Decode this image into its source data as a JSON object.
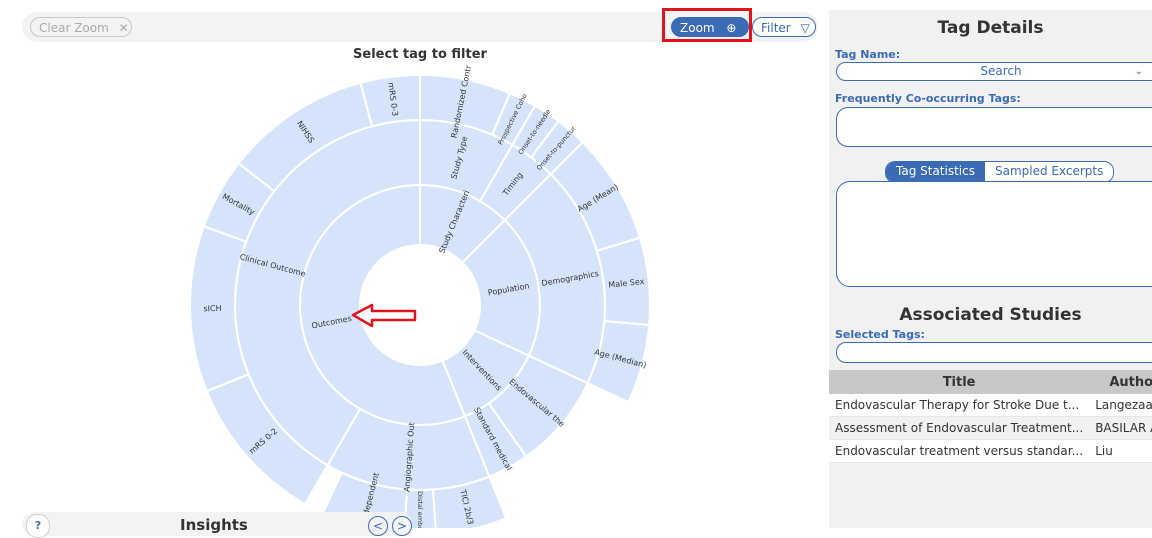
{
  "toolbar": {
    "clear_zoom_label": "Clear Zoom",
    "zoom_label": "Zoom",
    "filter_label": "Filter"
  },
  "sunburst": {
    "title": "Select tag to filter",
    "fill_color": "#d6e4fb",
    "center_label": "Outcomes",
    "labels": {
      "study_characteristics": "Study Characteri",
      "population": "Population",
      "interventions": "Interventions",
      "outcomes": "Outcomes",
      "study_type": "Study Type",
      "timing": "Timing",
      "demographics": "Demographics",
      "endovascular": "Endovascular the",
      "standard_medical": "Standard medical",
      "angiographic": "Angiographic Out",
      "clinical_outcome": "Clinical Outcome",
      "randomized": "Randomized Contr",
      "prospective": "Prospective Coho",
      "onset_needle": "Onset-to-needle",
      "onset_puncture": "Onset-to-punctur",
      "age_mean": "Age (Mean)",
      "male_sex": "Male Sex",
      "age_median": "Age (Median)",
      "tici_2b3": "TICI 2b/3",
      "distal_emboli": "Distal emboli",
      "tici_independent": "TICI independent",
      "mrs_02": "mRS 0-2",
      "sich": "sICH",
      "mortality": "Mortality",
      "nihss": "NIHSS",
      "mrs_03": "mRS 0-3"
    }
  },
  "insights": {
    "help_label": "?",
    "title": "Insights",
    "prev_label": "<",
    "next_label": ">"
  },
  "tag_details": {
    "title": "Tag Details",
    "tag_name_label": "Tag Name:",
    "search_placeholder": "Search",
    "cooccurring_label": "Frequently Co-occurring Tags:",
    "tab_stats": "Tag Statistics",
    "tab_excerpts": "Sampled Excerpts"
  },
  "associated_studies": {
    "title": "Associated Studies",
    "selected_tags_label": "Selected Tags:",
    "columns": [
      "Title",
      "Author"
    ],
    "rows": [
      {
        "title": "Endovascular Therapy for Stroke Due t...",
        "author": "Langezaal"
      },
      {
        "title": "Assessment of Endovascular Treatment...",
        "author": "BASILAR Ar..."
      },
      {
        "title": "Endovascular treatment versus standar...",
        "author": "Liu"
      }
    ]
  },
  "colors": {
    "accent": "#3b6bb5",
    "highlight": "#e1141e",
    "segment_fill": "#d6e4fb"
  }
}
